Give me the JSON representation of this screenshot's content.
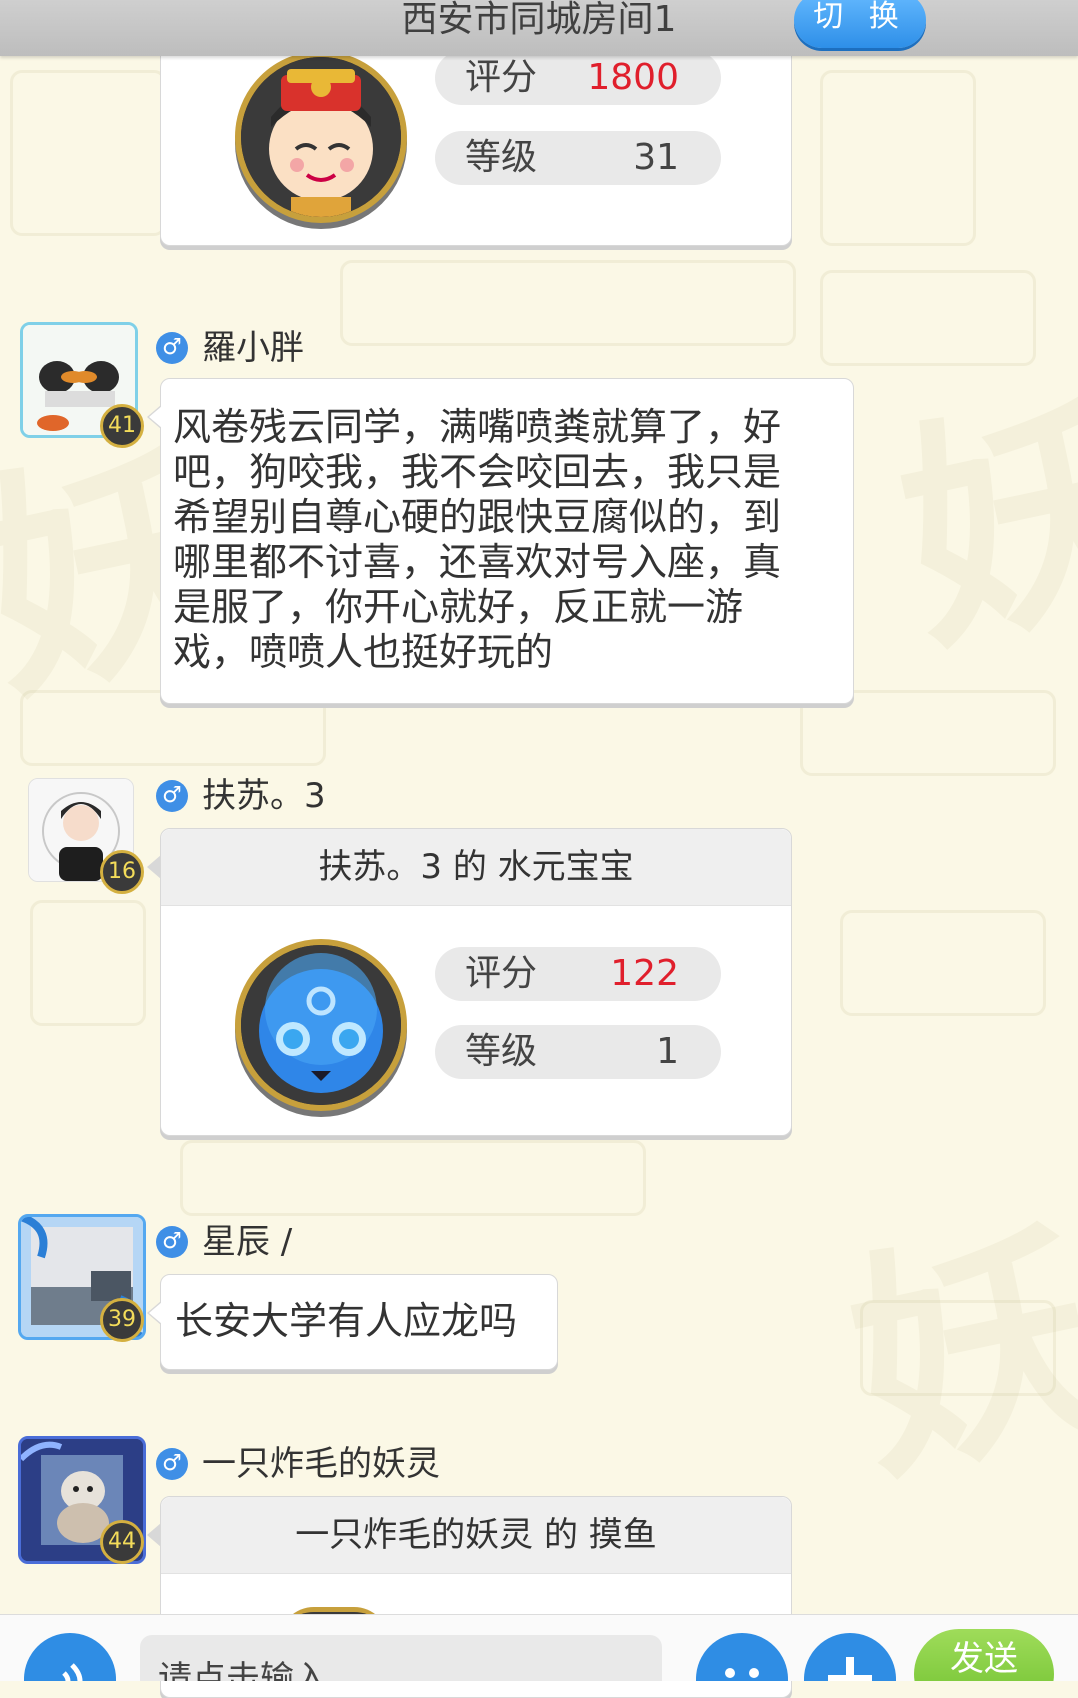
{
  "header": {
    "title": "西安市同城房间1",
    "switch_label": "切 换"
  },
  "top_card": {
    "stats": [
      {
        "label": "评分",
        "value": "1800"
      },
      {
        "label": "等级",
        "value": "31"
      }
    ]
  },
  "messages": [
    {
      "user": "羅小胖",
      "level": "41",
      "text": "风卷残云同学，满嘴喷粪就算了，好吧，狗咬我，我不会咬回去，我只是希望别自尊心硬的跟快豆腐似的，到哪里都不讨喜，还喜欢对号入座，真是服了，你开心就好，反正就一游戏，喷喷人也挺好玩的"
    },
    {
      "user": "扶苏。3",
      "level": "16",
      "card_title": "扶苏。3 的 水元宝宝",
      "stats": [
        {
          "label": "评分",
          "value": "122"
        },
        {
          "label": "等级",
          "value": "1"
        }
      ]
    },
    {
      "user": "星辰 /",
      "level": "39",
      "text": "长安大学有人应龙吗"
    },
    {
      "user": "一只炸毛的妖灵",
      "level": "44",
      "card_title": "一只炸毛的妖灵 的 摸鱼"
    }
  ],
  "gender_symbol": "♂",
  "input": {
    "placeholder": "请点击输入"
  },
  "send_label": "发送",
  "colors": {
    "accent_blue": "#2f8de4",
    "score_red": "#e01f2c",
    "send_green": "#7cc83a"
  }
}
